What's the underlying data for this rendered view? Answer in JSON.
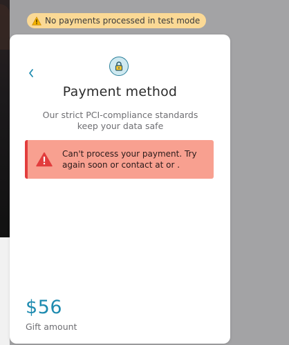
{
  "banner": {
    "text": "No payments processed in test mode",
    "icon": "warning-icon",
    "color": "#fbd995"
  },
  "card": {
    "back_icon": "chevron-left-icon",
    "lock_icon": "lock-icon",
    "title": "Payment method",
    "subtitle": "Our strict PCI-compliance standards keep your data safe",
    "error": {
      "icon": "alert-triangle-icon",
      "message": "Can't process your payment. Try again soon or contact at or .",
      "background": "#f8a090",
      "accent": "#e23d3d"
    },
    "amount": "$56",
    "amount_label": "Gift amount",
    "accent_color": "#1e8bb0"
  }
}
